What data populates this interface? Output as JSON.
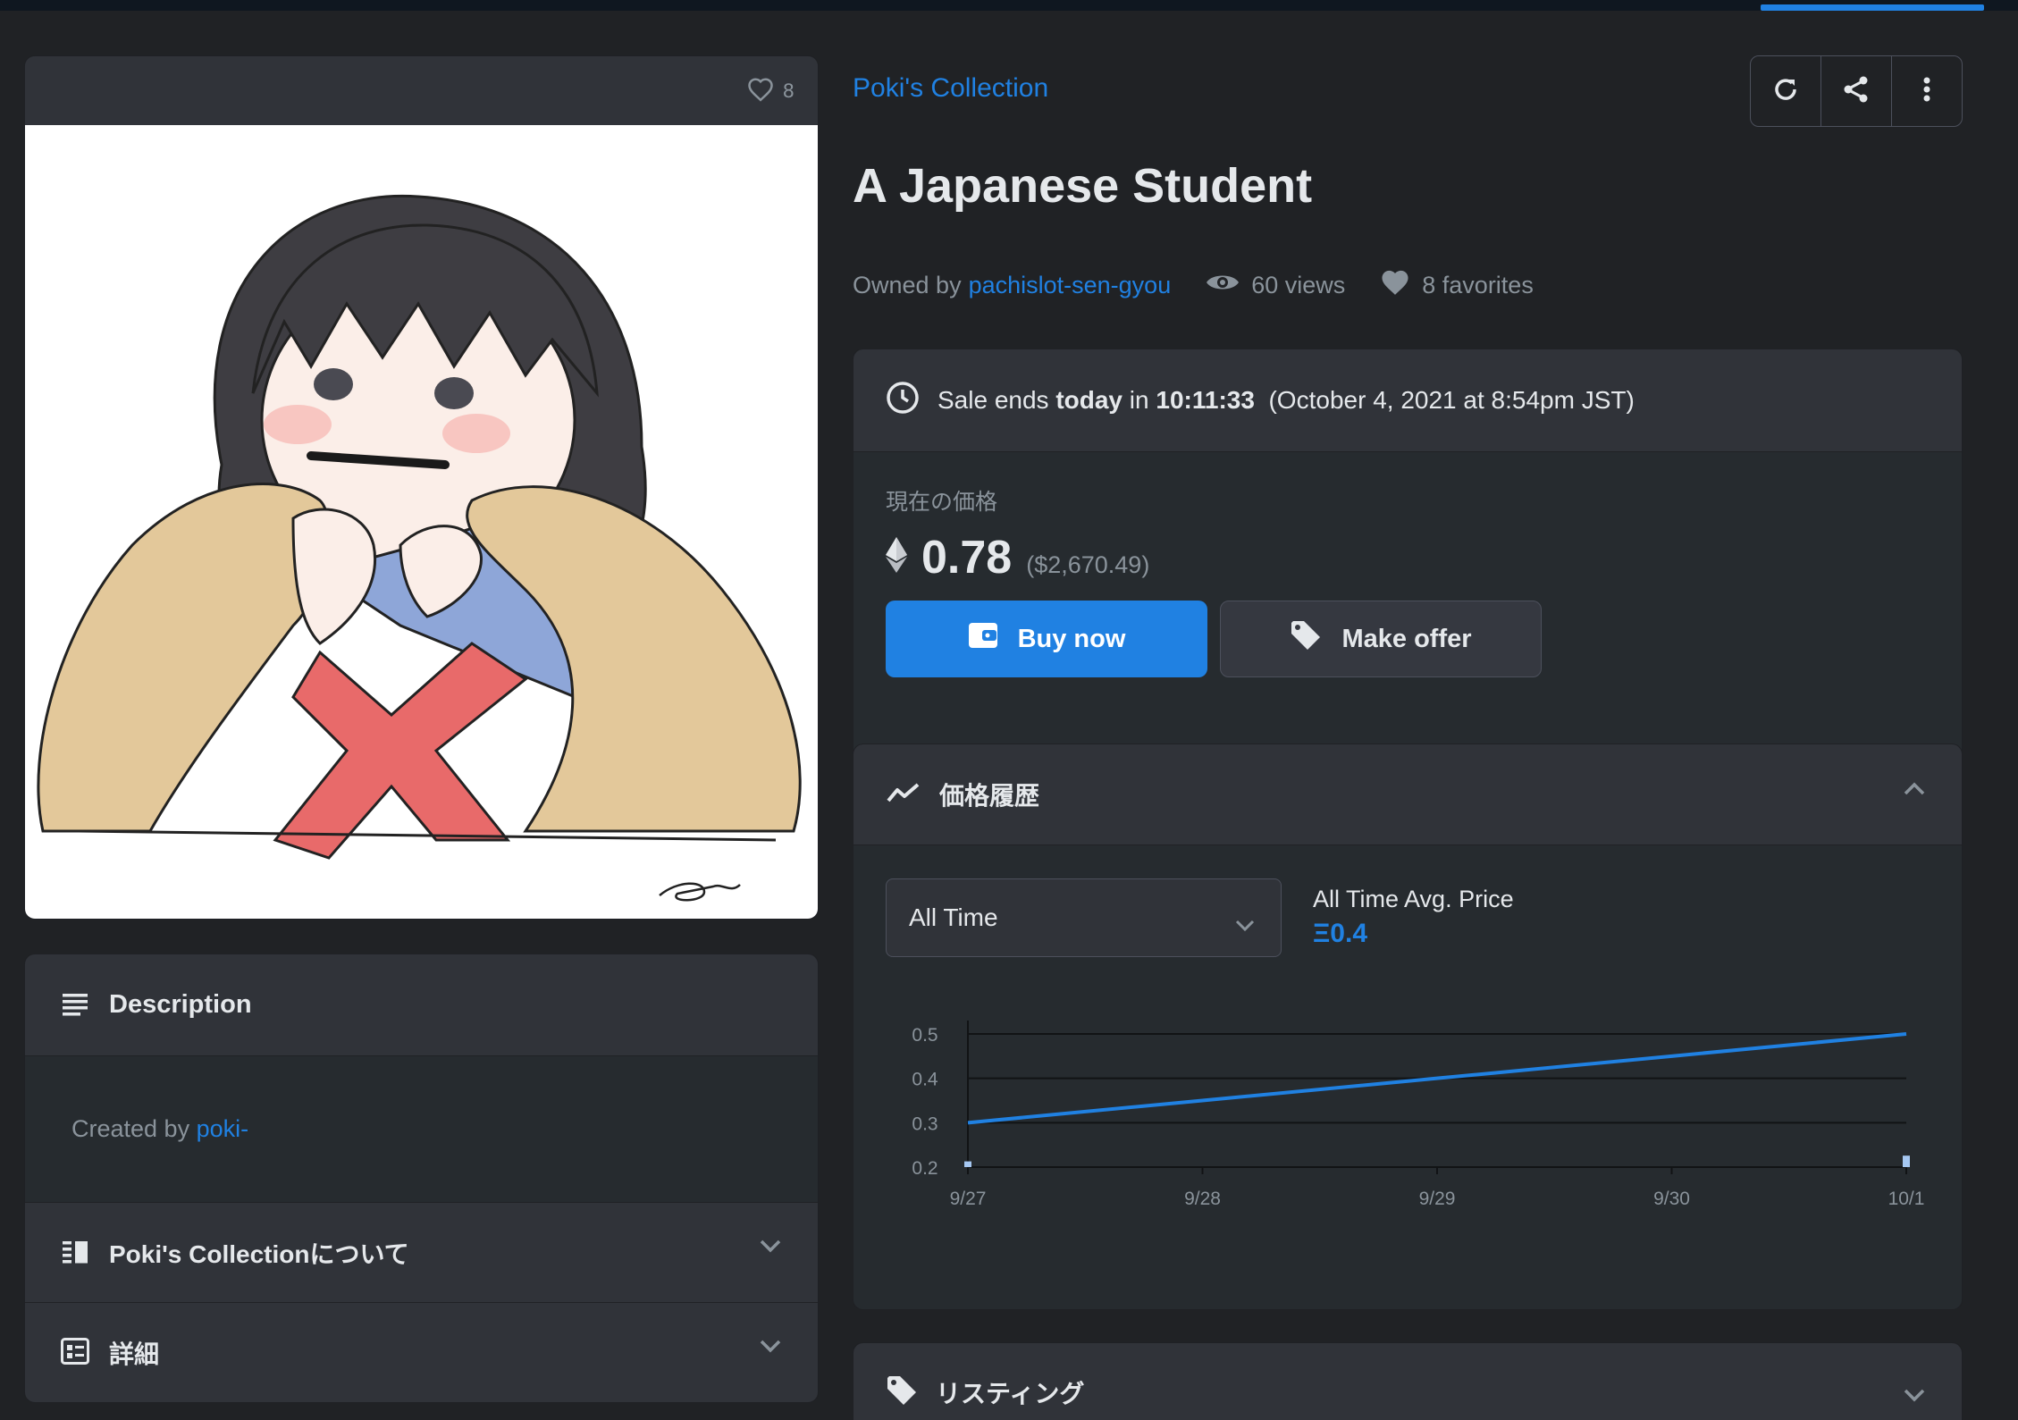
{
  "media": {
    "favorite_count": "8"
  },
  "description": {
    "title": "Description",
    "created_by_prefix": "Created by",
    "creator": "poki-"
  },
  "about": {
    "title": "Poki's Collectionについて"
  },
  "details": {
    "title": "詳細"
  },
  "collection": {
    "name": "Poki's Collection"
  },
  "nft": {
    "title": "A Japanese Student",
    "owned_by_label": "Owned by",
    "owner": "pachislot-sen-gyou",
    "views": "60 views",
    "favorites": "8 favorites"
  },
  "sale": {
    "ends_prefix": "Sale ends",
    "ends_day": "today",
    "ends_in": "in",
    "countdown": "10:11:33",
    "ends_date": "(October 4, 2021 at 8:54pm JST)",
    "price_label": "現在の価格",
    "price": "0.78",
    "price_usd": "($2,670.49)",
    "buy_label": "Buy now",
    "offer_label": "Make offer"
  },
  "price_history": {
    "title": "価格履歴",
    "range_selected": "All Time",
    "avg_label": "All Time Avg. Price",
    "avg_value": "Ξ0.4"
  },
  "listings": {
    "title": "リスティング"
  },
  "colors": {
    "accent": "#2081e2",
    "background": "#202225",
    "card": "#303339"
  },
  "chart_data": {
    "type": "line",
    "x": [
      "9/27",
      "9/28",
      "9/29",
      "9/30",
      "10/1"
    ],
    "y_ticks": [
      "0.5",
      "0.4",
      "0.3",
      "0.2"
    ],
    "ylim": [
      0.2,
      0.5
    ],
    "series": [
      {
        "values": [
          0.3,
          0.35,
          0.4,
          0.45,
          0.5
        ]
      }
    ],
    "volume_markers": [
      {
        "x": "9/27",
        "value": 0.02
      },
      {
        "x": "10/1",
        "value": 0.04
      }
    ]
  }
}
